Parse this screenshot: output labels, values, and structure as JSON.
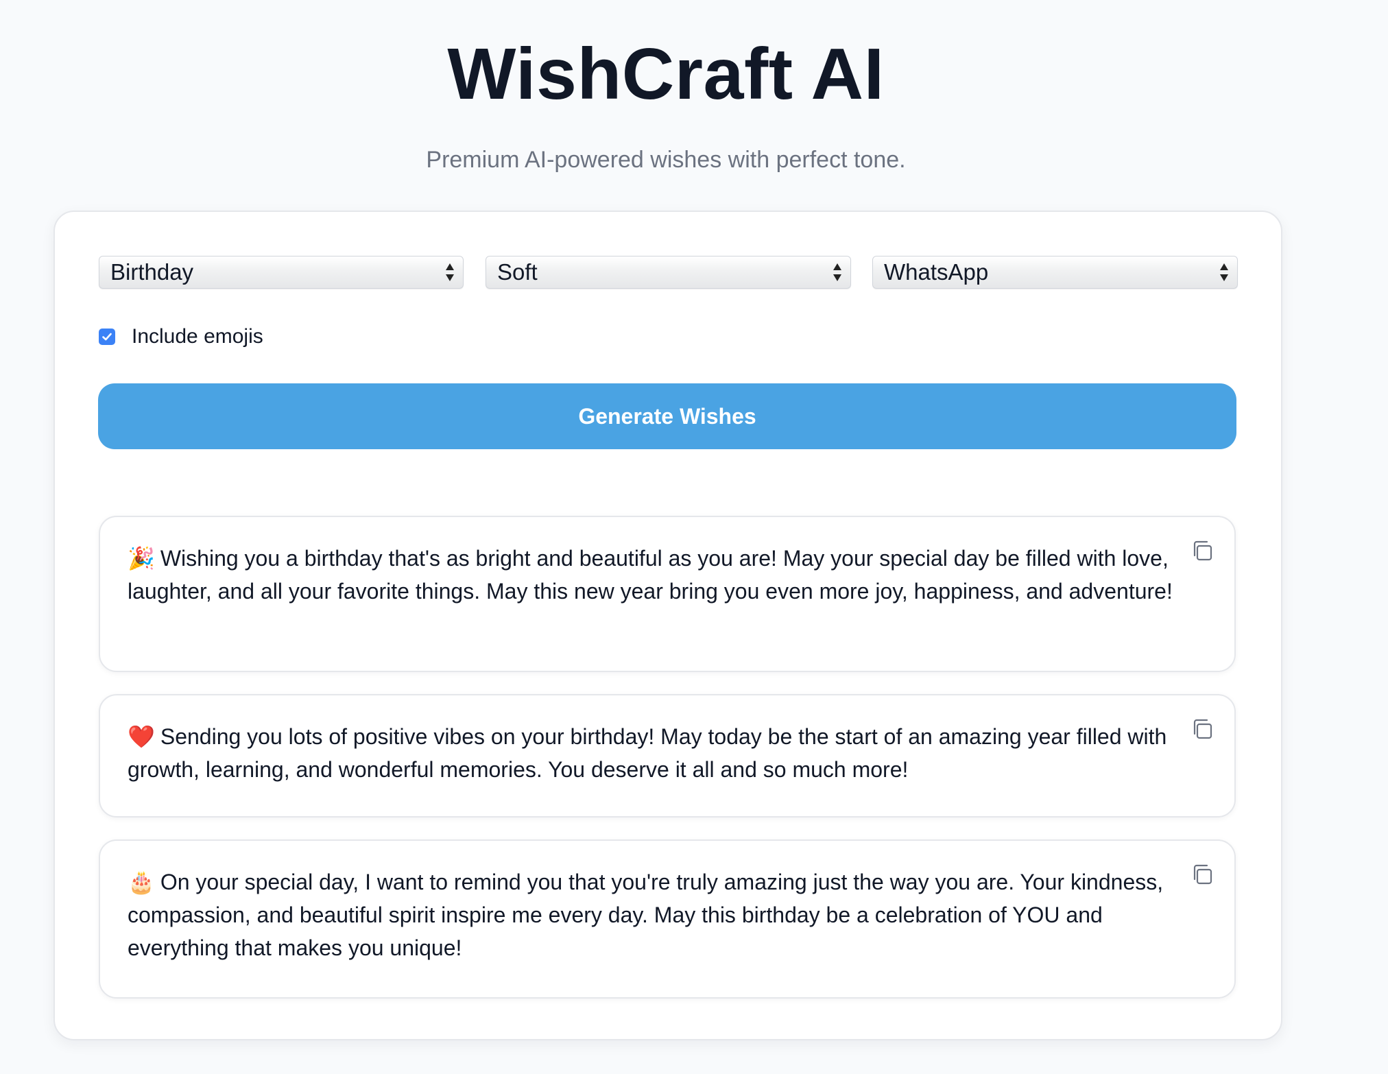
{
  "header": {
    "title": "WishCraft AI",
    "subtitle": "Premium AI-powered wishes with perfect tone."
  },
  "form": {
    "occasion": {
      "selected": "Birthday"
    },
    "tone": {
      "selected": "Soft"
    },
    "platform": {
      "selected": "WhatsApp"
    },
    "include_emojis": {
      "label": "Include emojis",
      "checked": true
    },
    "generate_button": {
      "label": "Generate Wishes"
    }
  },
  "wishes": [
    {
      "emoji": "🎉",
      "emoji_icon": "party-popper-icon",
      "text": "Wishing you a birthday that's as bright and beautiful as you are! May your special day be filled with love, laughter, and all your favorite things. May this new year bring you even more joy, happiness, and adventure!"
    },
    {
      "emoji": "❤️",
      "emoji_icon": "heart-icon",
      "text": "Sending you lots of positive vibes on your birthday! May today be the start of an amazing year filled with growth, learning, and wonderful memories. You deserve it all and so much more!"
    },
    {
      "emoji": "🎂",
      "emoji_icon": "birthday-cake-icon",
      "text": "On your special day, I want to remind you that you're truly amazing just the way you are. Your kindness, compassion, and beautiful spirit inspire me every day. May this birthday be a celebration of YOU and everything that makes you unique!"
    }
  ],
  "icons": {
    "select_arrow": "select-arrows-icon",
    "copy": "copy-icon",
    "checkmark": "checkmark-icon"
  },
  "colors": {
    "page_background": "#f8fafc",
    "accent_button": "#4aa3e3",
    "checkbox": "#3b82f6",
    "title_text": "#111827",
    "subtitle_text": "#6b7280"
  }
}
